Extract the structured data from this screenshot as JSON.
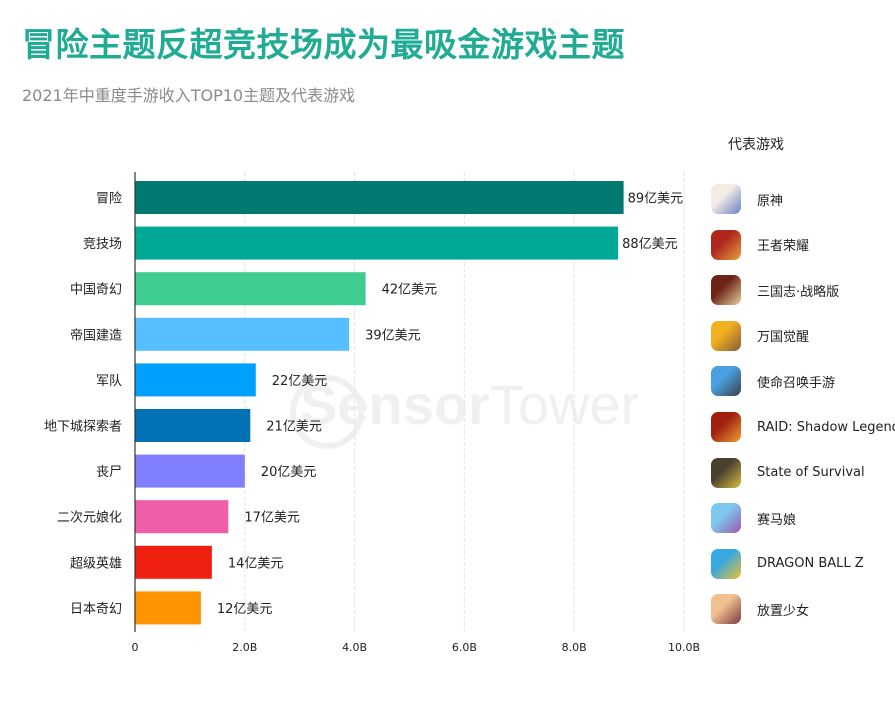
{
  "header": {
    "title": "冒险主题反超竞技场成为最吸金游戏主题",
    "subtitle": "2021年中重度手游收入TOP10主题及代表游戏"
  },
  "watermark": {
    "bold": "Sensor",
    "light": "Tower"
  },
  "chart_data": {
    "type": "bar",
    "orientation": "horizontal",
    "title": "2021年中重度手游收入TOP10主题及代表游戏",
    "xlabel": "",
    "ylabel": "",
    "categories": [
      "冒险",
      "竞技场",
      "中国奇幻",
      "帝国建造",
      "军队",
      "地下城探索者",
      "丧尸",
      "二次元娘化",
      "超级英雄",
      "日本奇幻"
    ],
    "values": [
      8.9,
      8.8,
      4.2,
      3.9,
      2.2,
      2.1,
      2.0,
      1.7,
      1.4,
      1.2
    ],
    "value_unit": "B USD",
    "data_labels": [
      "89亿美元",
      "88亿美元",
      "42亿美元",
      "39亿美元",
      "22亿美元",
      "21亿美元",
      "20亿美元",
      "17亿美元",
      "14亿美元",
      "12亿美元"
    ],
    "colors": [
      "#007a70",
      "#00a896",
      "#3ecc91",
      "#55bfff",
      "#00a0ff",
      "#0072b5",
      "#7f7fff",
      "#ef5fa7",
      "#ef2010",
      "#ff9400"
    ],
    "xlim": [
      0,
      10
    ],
    "xticks": [
      0,
      2,
      4,
      6,
      8,
      10
    ],
    "xtick_labels": [
      "0",
      "2.0B",
      "4.0B",
      "6.0B",
      "8.0B",
      "10.0B"
    ],
    "grid": "vertical-dashed",
    "legend": "none"
  },
  "games": {
    "header": "代表游戏",
    "items": [
      {
        "name": "原神",
        "icon": "genshin-impact-icon",
        "colors": [
          "#f3ece4",
          "#6a7fc8"
        ]
      },
      {
        "name": "王者荣耀",
        "icon": "honor-of-kings-icon",
        "colors": [
          "#b0281c",
          "#e4a040"
        ]
      },
      {
        "name": "三国志·战略版",
        "icon": "three-kingdoms-icon",
        "colors": [
          "#6e2418",
          "#e8d2a0"
        ]
      },
      {
        "name": "万国觉醒",
        "icon": "rise-of-kingdoms-icon",
        "colors": [
          "#f0b020",
          "#8a5a38"
        ]
      },
      {
        "name": "使命召唤手游",
        "icon": "call-of-duty-icon",
        "colors": [
          "#4aa0e0",
          "#3a4048"
        ]
      },
      {
        "name": "RAID: Shadow Legends",
        "icon": "raid-shadow-legends-icon",
        "colors": [
          "#a02010",
          "#f0a030"
        ]
      },
      {
        "name": "State of Survival",
        "icon": "state-of-survival-icon",
        "colors": [
          "#4a4030",
          "#d8c040"
        ]
      },
      {
        "name": "赛马娘",
        "icon": "uma-musume-icon",
        "colors": [
          "#7ec8f0",
          "#9a5ab0"
        ]
      },
      {
        "name": "DRAGON BALL Z",
        "icon": "dragon-ball-z-icon",
        "colors": [
          "#38a8e0",
          "#f0c030"
        ]
      },
      {
        "name": "放置少女",
        "icon": "idle-angels-icon",
        "colors": [
          "#f0c090",
          "#7a3a40"
        ]
      }
    ]
  }
}
